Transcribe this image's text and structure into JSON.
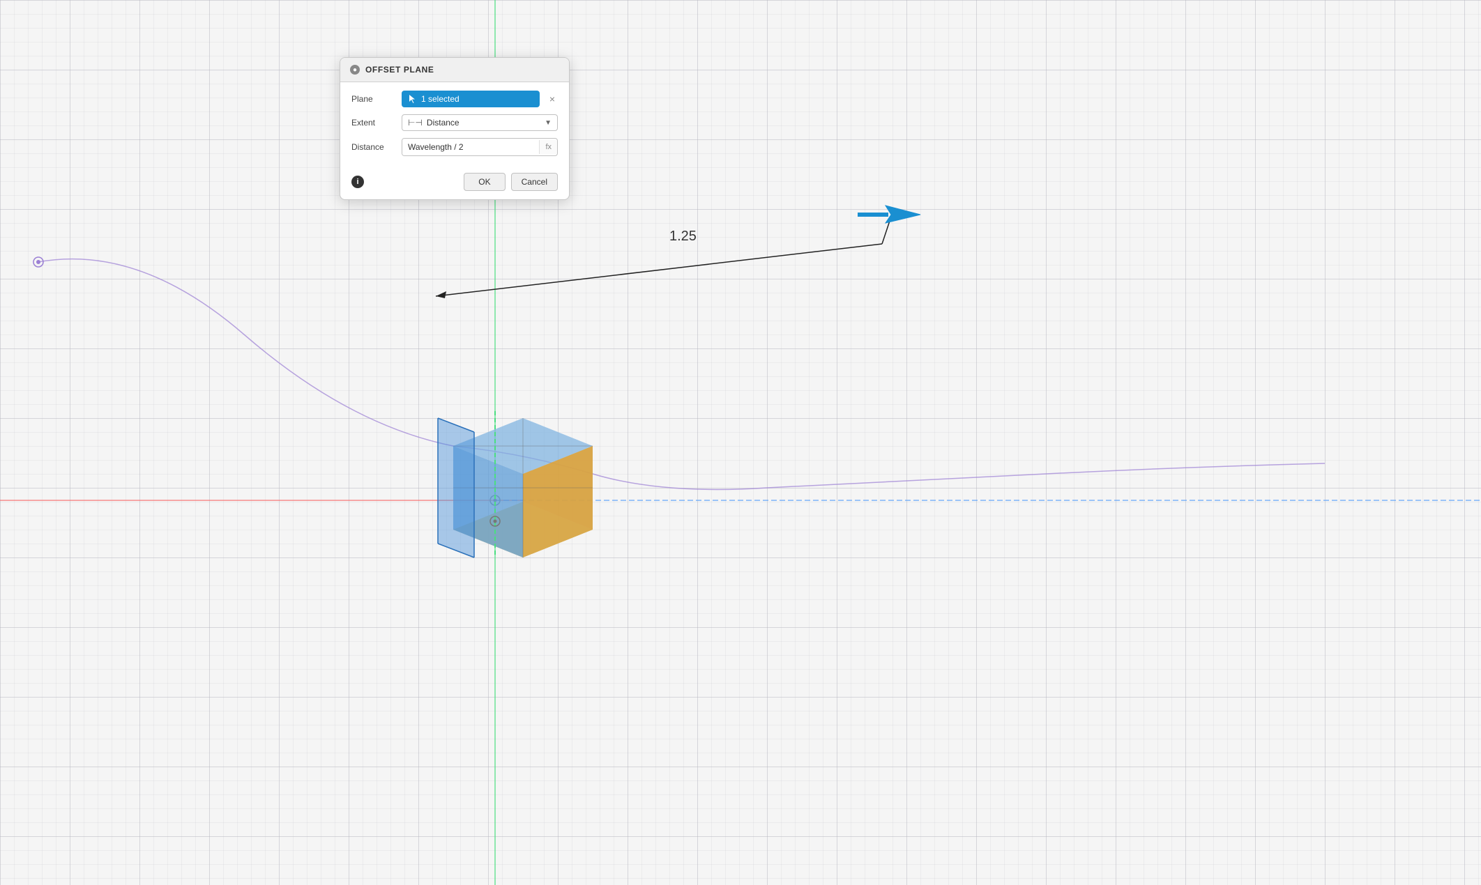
{
  "dialog": {
    "title": "OFFSET PLANE",
    "close_icon": "●",
    "fields": {
      "plane": {
        "label": "Plane",
        "selected_text": "1 selected",
        "clear_btn": "×"
      },
      "extent": {
        "label": "Extent",
        "value": "Distance",
        "icon": "⊢⊣"
      },
      "distance": {
        "label": "Distance",
        "value": "Wavelength / 2",
        "fx_label": "fx"
      }
    },
    "footer": {
      "info_icon": "i",
      "ok_label": "OK",
      "cancel_label": "Cancel"
    }
  },
  "viewport": {
    "dimension_value": "1.25"
  }
}
